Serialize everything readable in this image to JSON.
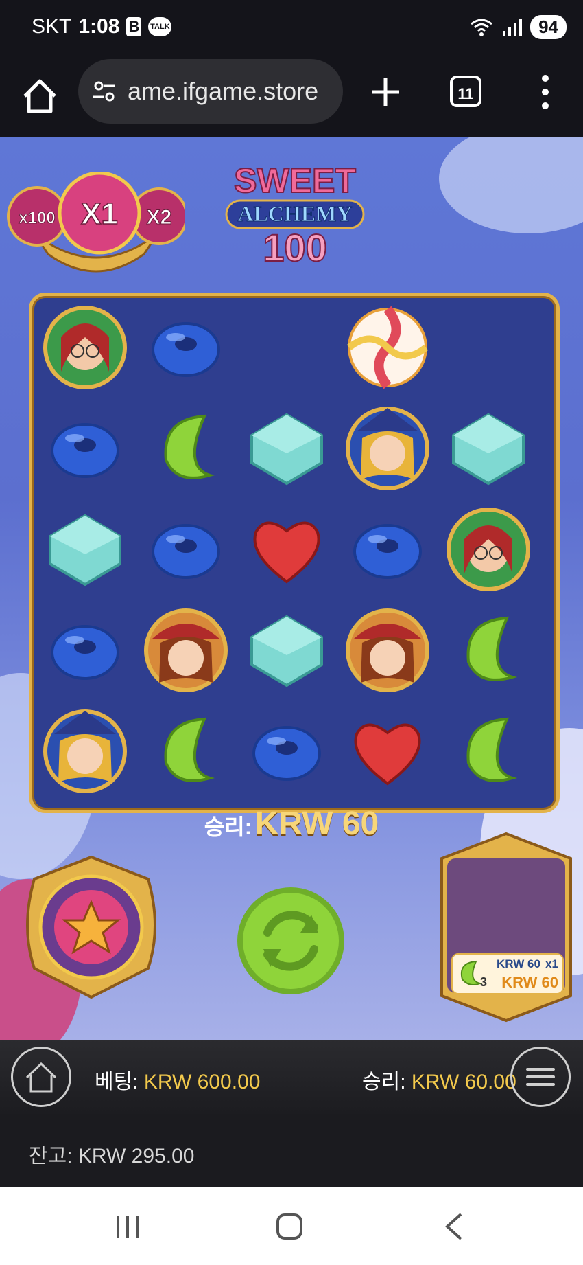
{
  "status_bar": {
    "carrier": "SKT",
    "time": "1:08",
    "notif_b": "B",
    "notif_talk": "TALK",
    "battery": "94"
  },
  "browser": {
    "url": "ame.ifgame.store",
    "tab_count": "11"
  },
  "game": {
    "logo_line1": "SWEET",
    "logo_line2": "ALCHEMY",
    "logo_line3": "100",
    "multipliers": {
      "left": "x100",
      "center": "X1",
      "right": "X2"
    },
    "win_label": "승리:",
    "win_amount": "KRW 60",
    "grid": [
      [
        "witch-red-glasses",
        "blue-donut",
        "",
        "swirl-candy-ball",
        ""
      ],
      [
        "blue-donut",
        "green-bean",
        "teal-cube",
        "witch-blonde",
        "teal-cube"
      ],
      [
        "teal-cube",
        "blue-donut",
        "red-heart",
        "blue-donut",
        "witch-red-glasses"
      ],
      [
        "blue-donut",
        "witch-redhead",
        "teal-cube",
        "witch-redhead",
        "green-bean"
      ],
      [
        "witch-blonde",
        "green-bean",
        "blue-donut",
        "red-heart",
        "green-bean"
      ]
    ],
    "history": {
      "count": "3",
      "amount": "KRW 60",
      "multiplier": "x1",
      "total": "KRW 60"
    }
  },
  "game_bar": {
    "bet_label": "베팅:",
    "bet_value": "KRW 600.00",
    "win_label": "승리:",
    "win_value": "KRW 60.00"
  },
  "balance": {
    "label": "잔고:",
    "value": "KRW 295.00"
  },
  "colors": {
    "gold": "#f2c94c",
    "board": "#2f3e8f",
    "spin": "#8fd43a"
  }
}
